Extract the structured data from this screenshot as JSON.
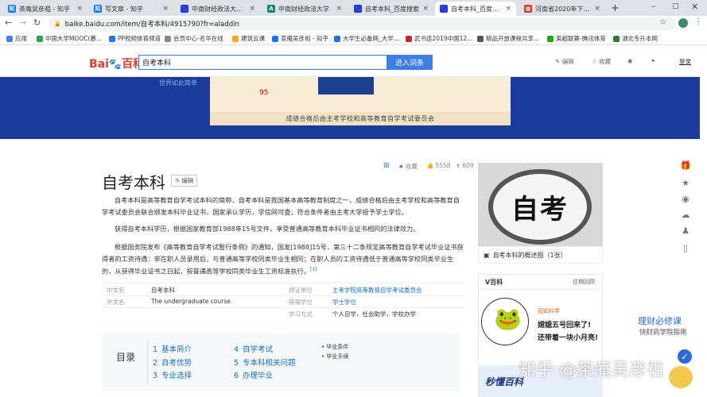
{
  "tabs": [
    {
      "label": "茶庵吴彦祖 - 知乎",
      "color": "#1772f6",
      "glyph": "知"
    },
    {
      "label": "写文章 - 知乎",
      "color": "#1772f6",
      "glyph": "知"
    },
    {
      "label": "中南财经政法大学_百",
      "color": "#2932e1",
      "glyph": "🐾"
    },
    {
      "label": "中南财经政法大学",
      "color": "#0e8a6b",
      "glyph": "A"
    },
    {
      "label": "自考本科_百度搜索",
      "color": "#2932e1",
      "glyph": "🐾"
    },
    {
      "label": "自考本科_百度百科",
      "color": "#2932e1",
      "glyph": "🐾"
    },
    {
      "label": "河南省2020年下半年",
      "color": "#d33",
      "glyph": "▦"
    }
  ],
  "address": "baike.baidu.com/item/自考本科/4915790?fr=aladdin",
  "bookmarks": [
    {
      "label": "应用",
      "color": "#4285f4"
    },
    {
      "label": "中国大学MOOC(慕...",
      "color": "#2aa45a"
    },
    {
      "label": "PP视频体育频道",
      "color": "#1d7be8"
    },
    {
      "label": "会员中心-名华在线",
      "color": "#888"
    },
    {
      "label": "建筑云课",
      "color": "#f5a623"
    },
    {
      "label": "茶庵吴彦祖 - 知乎",
      "color": "#1772f6"
    },
    {
      "label": "大学生必备网_大学...",
      "color": "#1a73e8"
    },
    {
      "label": "武书连2019中国12...",
      "color": "#c62828"
    },
    {
      "label": "精品开放课程共享...",
      "color": "#555"
    },
    {
      "label": "英超联赛-腾讯体育",
      "color": "#1aad19"
    },
    {
      "label": "湖北专升本网",
      "color": "#2e7d32"
    }
  ],
  "header": {
    "logo_bai": "Bai",
    "logo_du": "du",
    "logo_baike": "百科",
    "search_value": "自考本科",
    "search_button": "进入词条",
    "edit": "编辑",
    "collect": "收藏",
    "login": "登录"
  },
  "banner": {
    "slogan": "世界如此简单",
    "number": "95",
    "caption": "成绩合格后由主考学校和高等教育自学考试委员会"
  },
  "article": {
    "title": "自考本科",
    "edit_label": "编辑",
    "collect_label": "收藏",
    "likes": "5558",
    "shares": "609",
    "p1": "自考本科是高等教育自学考试本科的简称，自考本科是我国基本高等教育制度之一，成绩合格后由主考学校和高等教育自学考试委员会联合颁发本科毕业证书，国家承认学历，学信网可查，符合条件者由主考大学授予学士学位。",
    "p2": "获得自考本科学历，根据国家教育部1988年15号文件，享受普通高等教育本科毕业证书相同的法律效力。",
    "p3": "根据国务院发布《高等教育自学考试暂行条例》的通知，国发[1988]15号，第三十二条规定高等教育自学考试毕业证书获得者的工资待遇：非在职人员录用后，与普通高等学校同类毕业生相同；在职人员的工资待遇低于普通高等学校同类毕业生的，从获得毕业证书之日起，按普通高等学校同类毕业生工资标准执行。",
    "p3_ref": "[1]"
  },
  "infobox": {
    "k1": "中文名",
    "v1": "自考本科",
    "k2": "外文名",
    "v2": "The undergraduate course",
    "k3": "颁证单位",
    "v3": "主考学院高等教育自学考试委员会",
    "k4": "获得学位",
    "v4": "学士学位",
    "k5": "学习方式",
    "v5": "个人自学，社会助学，学校办学"
  },
  "catalog": {
    "title": "目录",
    "items": [
      {
        "num": "1",
        "label": "基本简介"
      },
      {
        "num": "2",
        "label": "自考优势"
      },
      {
        "num": "3",
        "label": "专业选择"
      },
      {
        "num": "4",
        "label": "自学考试"
      },
      {
        "num": "5",
        "label": "专本科相关问题"
      },
      {
        "num": "6",
        "label": "办理毕业"
      }
    ],
    "subs": [
      "毕业条件",
      "毕业手续"
    ]
  },
  "sidebar": {
    "image_text": "自考",
    "album_caption": "自考本科的概述图（1张）",
    "v_title": "V百科",
    "v_more": "往期回顾",
    "v_tag": "冠知科学",
    "v_h1": "嫦娥五号回来了!",
    "v_h2": "还带着一块小月亮!",
    "bottom": "秒懂百科"
  },
  "ad": {
    "title": "理财必修课",
    "subtitle": "快财商学院指南"
  },
  "watermark": "知乎 @茶庵吴彦祖"
}
